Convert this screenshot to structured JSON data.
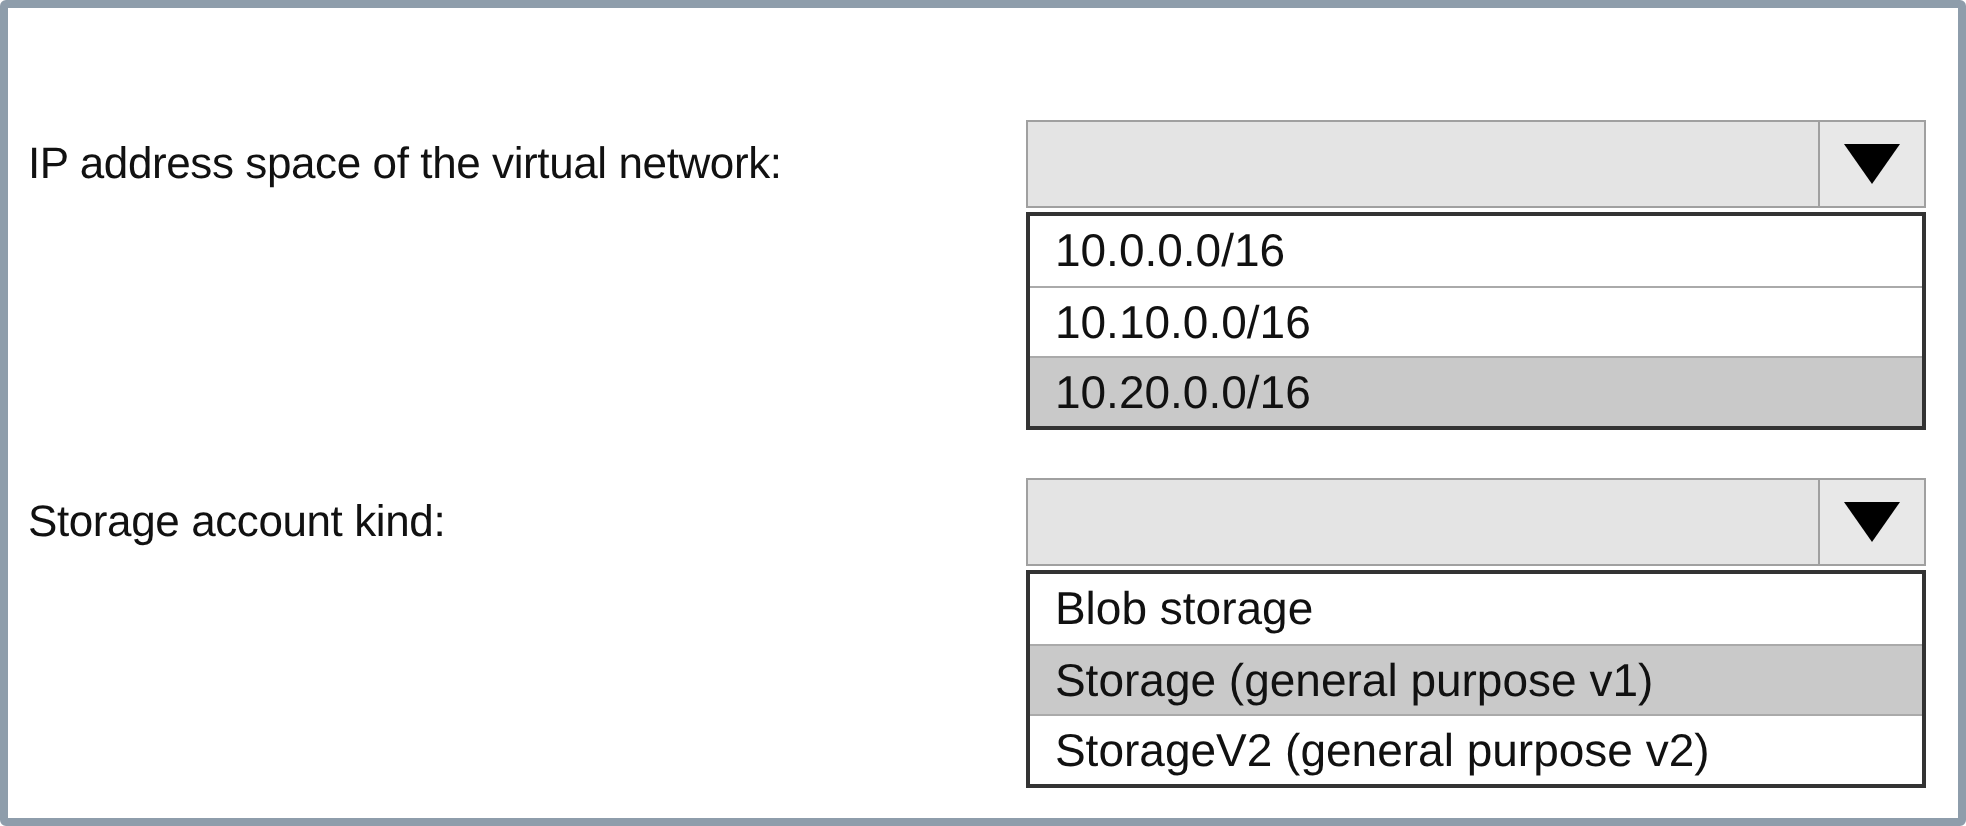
{
  "questions": [
    {
      "label": "IP address space of the virtual network:",
      "options": [
        {
          "text": "10.0.0.0/16",
          "selected": false
        },
        {
          "text": "10.10.0.0/16",
          "selected": false
        },
        {
          "text": "10.20.0.0/16",
          "selected": true
        }
      ]
    },
    {
      "label": "Storage account kind:",
      "options": [
        {
          "text": "Blob storage",
          "selected": false
        },
        {
          "text": "Storage (general purpose v1)",
          "selected": true
        },
        {
          "text": "StorageV2 (general purpose v2)",
          "selected": false
        }
      ]
    }
  ]
}
